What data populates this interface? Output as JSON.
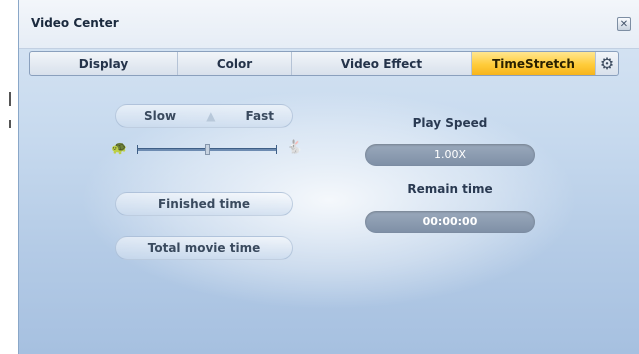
{
  "window": {
    "title": "Video Center",
    "close_icon": "close-icon"
  },
  "tabs": [
    {
      "label": "Display",
      "active": false
    },
    {
      "label": "Color",
      "active": false
    },
    {
      "label": "Video Effect",
      "active": false
    },
    {
      "label": "TimeStretch",
      "active": true
    }
  ],
  "settings_icon": "gear-icon",
  "speed_control": {
    "slow_label": "Slow",
    "fast_label": "Fast",
    "slow_icon": "turtle-icon",
    "fast_icon": "rabbit-icon",
    "slider_value_fraction": 0.5
  },
  "buttons": {
    "finished_time": "Finished time",
    "total_movie_time": "Total movie time"
  },
  "play_speed": {
    "label": "Play Speed",
    "value": "1.00X"
  },
  "remain_time": {
    "label": "Remain time",
    "value": "00:00:00"
  },
  "colors": {
    "active_tab": "#ffcc3a",
    "display_bg": "#8a9bb1"
  }
}
